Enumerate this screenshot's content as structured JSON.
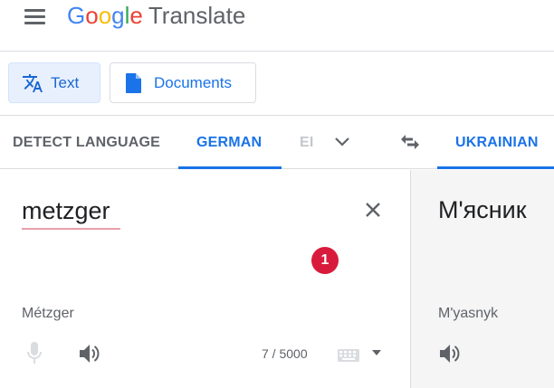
{
  "header": {
    "logo_letters": [
      "G",
      "o",
      "o",
      "g",
      "l",
      "e"
    ],
    "logo_colors": [
      "#4285f4",
      "#ea4335",
      "#fbbc05",
      "#4285f4",
      "#34a853",
      "#ea4335"
    ],
    "product_name": "Translate"
  },
  "modes": {
    "text_label": "Text",
    "documents_label": "Documents",
    "active": "Text"
  },
  "languages": {
    "detect_label": "DETECT LANGUAGE",
    "source_label": "GERMAN",
    "partial_label": "EI",
    "target_label": "UKRAINIAN"
  },
  "source": {
    "text": "metzger",
    "transliteration": "Métzger",
    "char_count": "7 / 5000",
    "badge": "1"
  },
  "target": {
    "text": "М'ясник",
    "transliteration": "M'yasnyk"
  },
  "colors": {
    "accent": "#1a73e8",
    "badge": "#d81b3c",
    "target_bg": "#f5f5f5"
  },
  "icons": {
    "menu": "hamburger-menu-icon",
    "text_mode": "translate-icon",
    "documents": "document-icon",
    "expand": "chevron-down-icon",
    "swap": "swap-arrows-icon",
    "clear": "close-icon",
    "mic": "microphone-icon",
    "speaker": "speaker-icon",
    "keyboard": "keyboard-icon"
  }
}
